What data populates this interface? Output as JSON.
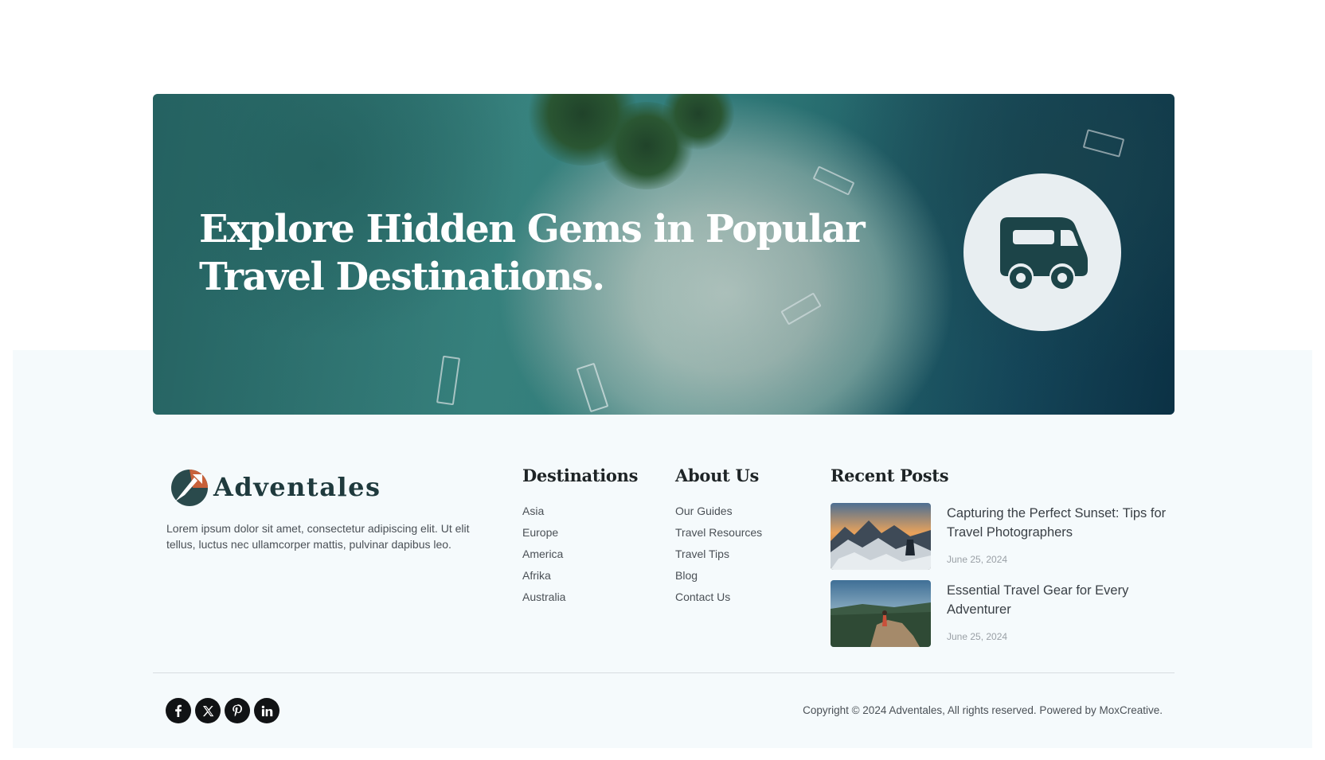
{
  "hero": {
    "title": "Explore Hidden Gems in Popular Travel Destinations.",
    "icon": "camper-van-icon"
  },
  "brand": {
    "name": "Adventales",
    "description": "Lorem ipsum dolor sit amet, consectetur adipiscing elit. Ut elit tellus, luctus nec ullamcorper mattis, pulvinar dapibus leo."
  },
  "destinations": {
    "title": "Destinations",
    "items": [
      "Asia",
      "Europe",
      "America",
      "Afrika",
      "Australia"
    ]
  },
  "about_us": {
    "title": "About Us",
    "items": [
      "Our Guides",
      "Travel Resources",
      "Travel Tips",
      "Blog",
      "Contact Us"
    ]
  },
  "recent_posts": {
    "title": "Recent Posts",
    "posts": [
      {
        "title": "Capturing the Perfect Sunset: Tips for Travel Photographers",
        "date": "June 25, 2024"
      },
      {
        "title": "Essential Travel Gear for Every Adventurer",
        "date": "June 25, 2024"
      }
    ]
  },
  "social": [
    "facebook-icon",
    "x-icon",
    "pinterest-icon",
    "linkedin-icon"
  ],
  "copyright": "Copyright © 2024 Adventales, All rights reserved. Powered by MoxCreative.",
  "colors": {
    "brand_dark": "#1f3a3d",
    "footer_bg": "#f5fafc",
    "logo_accent": "#c8613a"
  }
}
